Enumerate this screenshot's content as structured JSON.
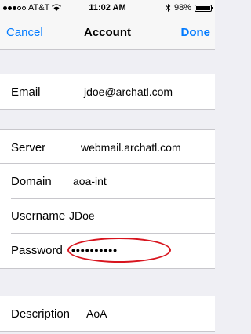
{
  "status_bar": {
    "carrier": "AT&T",
    "time": "11:02 AM",
    "battery": "98%",
    "battery_level": 0.98,
    "signal_bars_filled": 3,
    "signal_bars_total": 5
  },
  "nav": {
    "cancel_label": "Cancel",
    "title": "Account",
    "done_label": "Done"
  },
  "account": {
    "email_label": "Email",
    "email_value": "jdoe@archatl.com",
    "server_label": "Server",
    "server_value": "webmail.archatl.com",
    "domain_label": "Domain",
    "domain_value": "aoa-int",
    "username_label": "Username",
    "username_value": "JDoe",
    "password_label": "Password",
    "password_value": "••••••••••",
    "description_label": "Description",
    "description_value": "AoA"
  },
  "colors": {
    "accent": "#007aff",
    "highlight": "#d8141e"
  }
}
